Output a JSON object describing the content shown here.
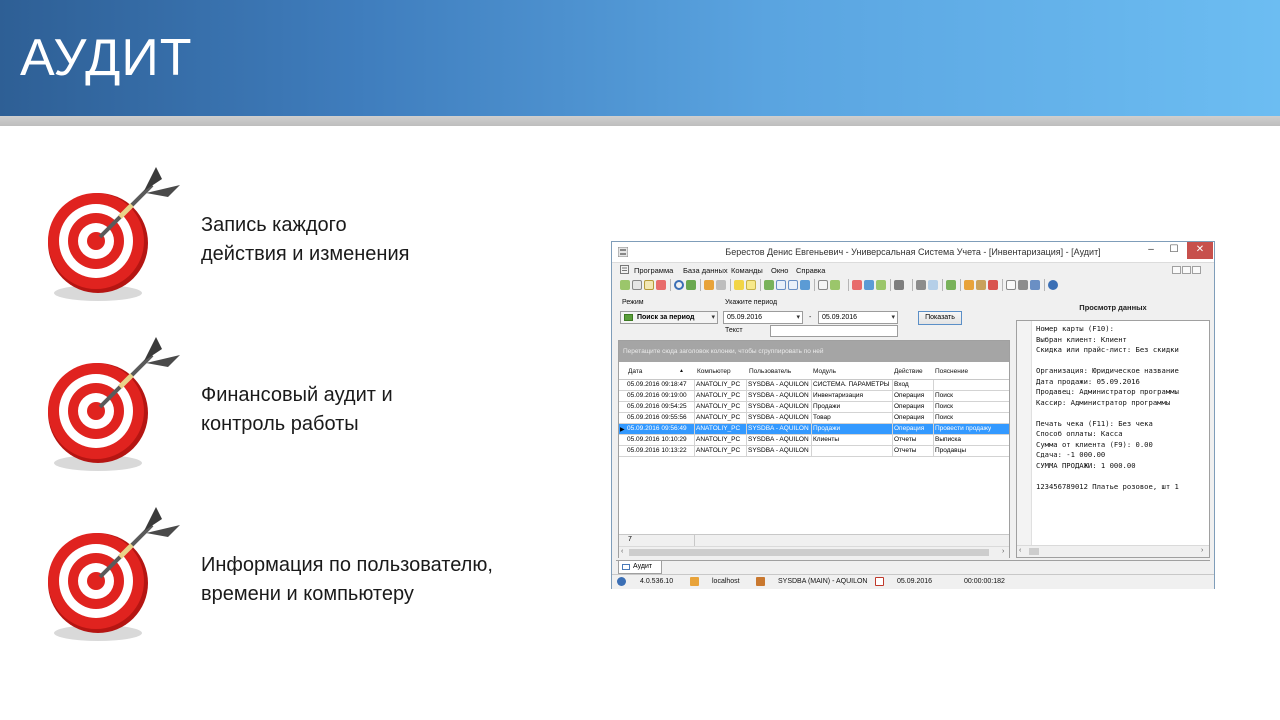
{
  "slide": {
    "title": "АУДИТ",
    "bullets": [
      {
        "line1": "Запись каждого",
        "line2": "действия и изменения",
        "icon": "target-icon"
      },
      {
        "line1": "Финансовый аудит и",
        "line2": "контроль работы",
        "icon": "target-icon"
      },
      {
        "line1": "Информация по пользователю,",
        "line2": "времени и компьютеру",
        "icon": "target-icon"
      }
    ]
  },
  "window": {
    "title": "Берестов Денис Евгеньевич - Универсальная Система Учета - [Инвентаризация] - [Аудит]",
    "controls": {
      "minimize": "–",
      "maximize": "☐",
      "close": "✕"
    },
    "menu": [
      "Программа",
      "База данных",
      "Команды",
      "Окно",
      "Справка"
    ],
    "filters": {
      "mode_label": "Режим",
      "mode_value": "Поиск за период",
      "period_label": "Укажите период",
      "date_from": "05.09.2016",
      "date_dash": "-",
      "date_to": "05.09.2016",
      "show_button": "Показать",
      "text_label": "Текст",
      "text_value": ""
    },
    "grid": {
      "group_hint": "Перетащите сюда заголовок колонки, чтобы сгруппировать по ней",
      "columns": [
        "Дата",
        "Компьютер",
        "Пользователь",
        "Модуль",
        "Действие",
        "Пояснение"
      ],
      "rows": [
        [
          "05.09.2016 09:18:47",
          "ANATOLIY_PC",
          "SYSDBA - AQUILON",
          "СИСТЕМА. ПАРАМЕТРЫ",
          "Вход",
          ""
        ],
        [
          "05.09.2016 09:19:00",
          "ANATOLIY_PC",
          "SYSDBA - AQUILON",
          "Инвентаризация",
          "Операция",
          "Поиск"
        ],
        [
          "05.09.2016 09:54:25",
          "ANATOLIY_PC",
          "SYSDBA - AQUILON",
          "Продажи",
          "Операция",
          "Поиск"
        ],
        [
          "05.09.2016 09:55:56",
          "ANATOLIY_PC",
          "SYSDBA - AQUILON",
          "Товар",
          "Операция",
          "Поиск"
        ],
        [
          "05.09.2016 09:56:49",
          "ANATOLIY_PC",
          "SYSDBA - AQUILON",
          "Продажи",
          "Операция",
          "Провести продажу"
        ],
        [
          "05.09.2016 10:10:29",
          "ANATOLIY_PC",
          "SYSDBA - AQUILON",
          "Клиенты",
          "Отчеты",
          "Выписка"
        ],
        [
          "05.09.2016 10:13:22",
          "ANATOLIY_PC",
          "SYSDBA - AQUILON",
          "",
          "Отчеты",
          "Продавцы"
        ]
      ],
      "selected_row": 4,
      "footer_count": "7"
    },
    "preview": {
      "title": "Просмотр данных",
      "lines": [
        "Номер карты (F10):",
        "Выбран клиент: Клиент",
        "Скидка или прайс-лист: Без скидки",
        "",
        "Организация: Юридическое название",
        "Дата продажи: 05.09.2016",
        "Продавец: Администратор программы",
        "Кассир: Администратор программы",
        "",
        "Печать чека (F11): Без чека",
        "Способ оплаты: Касса",
        "Сумма от клиента (F9): 0.00",
        "Сдача: -1 000.00",
        "СУММА ПРОДАЖИ: 1 000.00",
        "",
        "123456789012 Платье розовое, шт 1"
      ]
    },
    "tab": "Аудит",
    "status": {
      "version": "4.0.536.10",
      "server": "localhost",
      "user": "SYSDBA (MAIN) - AQUILON",
      "date": "05.09.2016",
      "timer": "00:00:00:182"
    }
  },
  "colors": {
    "header_dark": "#2e5f95",
    "header_light": "#6cbdf2",
    "selection": "#3399ff",
    "close_button": "#c7504c",
    "target_red": "#e0231f"
  }
}
